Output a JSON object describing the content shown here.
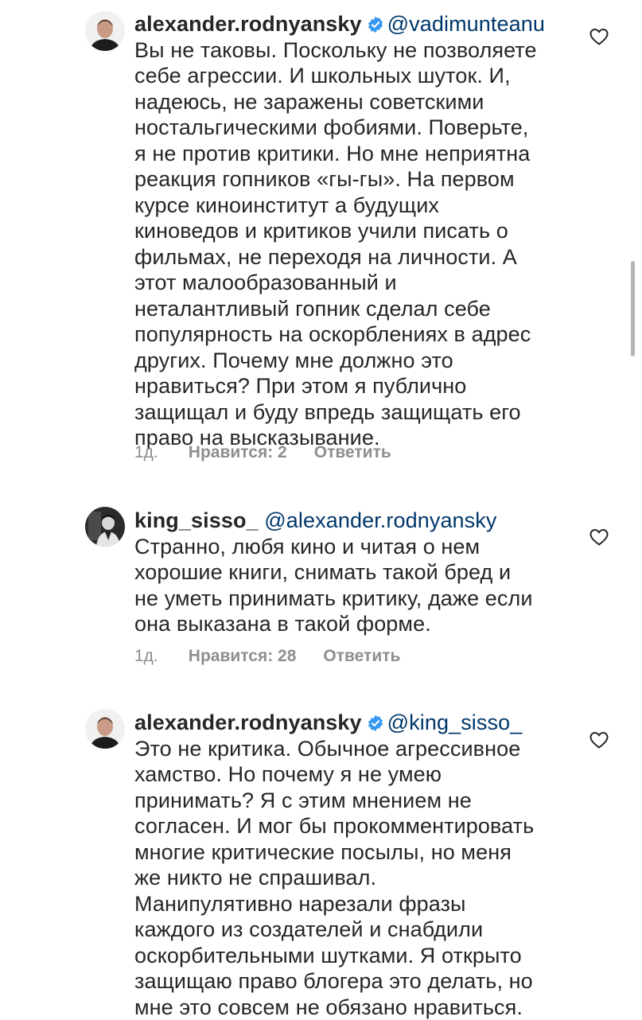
{
  "colors": {
    "text": "#262626",
    "mention": "#00376b",
    "meta": "#8e8e8e",
    "verified": "#3897f0"
  },
  "comments": [
    {
      "username": "alexander.rodnyansky",
      "verified": true,
      "mention": "@vadimunteanu",
      "lines": [
        "Вы не таковы. Поскольку не позволяете",
        "себе агрессии. И школьных шуток. И,",
        "надеюсь, не заражены советскими",
        "ностальгическими фобиями. Поверьте,",
        "я не против критики. Но мне неприятна",
        "реакция гопников «гы-гы». На первом",
        "курсе киноинститут а будущих",
        "киноведов и критиков учили писать о",
        "фильмах, не переходя на личности. А",
        "этот малообразованный и",
        "неталантливый гопник сделал себе",
        "популярность на оскорблениях в адрес",
        "других. Почему мне должно это",
        "нравиться? При этом я публично",
        "защищал и буду впредь защищать его",
        "право на высказывание."
      ],
      "time": "1д.",
      "likes": "Нравится: 2",
      "reply": "Ответить",
      "avatar_icon": "avatar-man-icon"
    },
    {
      "username": "king_sisso_",
      "verified": false,
      "mention": "@alexander.rodnyansky",
      "lines": [
        "Странно, любя кино и читая о нем",
        "хорошие книги, снимать такой бред и",
        "не уметь принимать критику, даже если",
        "она выказана в такой форме."
      ],
      "time": "1д.",
      "likes": "Нравится: 28",
      "reply": "Ответить",
      "avatar_icon": "avatar-dark-photo-icon"
    },
    {
      "username": "alexander.rodnyansky",
      "verified": true,
      "mention": "@king_sisso_",
      "lines": [
        "Это не критика. Обычное агрессивное",
        "хамство. Но почему я не умею",
        "принимать? Я с этим мнением не",
        "согласен. И мог бы прокомментировать",
        "многие критические посылы, но меня",
        "же никто не спрашивал.",
        "Манипулятивно нарезали фразы",
        "каждого из создателей и снабдили",
        "оскорбительными шутками. Я открыто",
        "защищаю право блогера это делать, но",
        "мне это совсем не обязано нравиться."
      ],
      "avatar_icon": "avatar-man-icon"
    }
  ]
}
